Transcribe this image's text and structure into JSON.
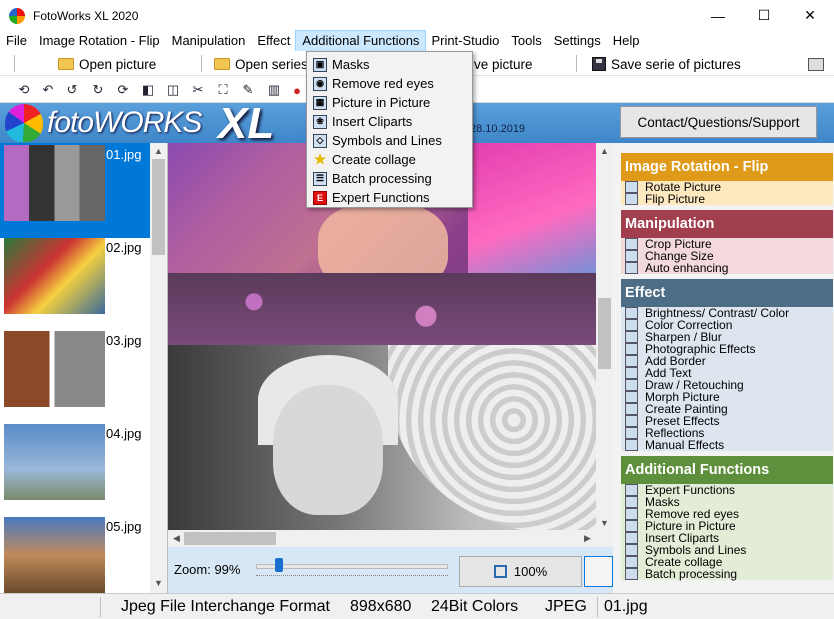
{
  "window": {
    "title": "FotoWorks XL 2020",
    "controls": {
      "minimize": "—",
      "maximize": "☐",
      "close": "✕"
    }
  },
  "menu": [
    "File",
    "Image Rotation - Flip",
    "Manipulation",
    "Effect",
    "Additional Functions",
    "Print-Studio",
    "Tools",
    "Settings",
    "Help"
  ],
  "toolbar": {
    "open_picture": "Open picture",
    "open_series": "Open series",
    "save_picture": "ve picture",
    "save_series": "Save serie of pictures"
  },
  "banner": {
    "logo_text": "fotoWORKS",
    "logo_xl": "XL",
    "date": "28.10.2019",
    "contact": "Contact/Questions/Support"
  },
  "dropdown": [
    {
      "label": "Masks",
      "icon": "masks-icon"
    },
    {
      "label": "Remove red eyes",
      "icon": "eye-icon"
    },
    {
      "label": "Picture in Picture",
      "icon": "picture-in-picture-icon"
    },
    {
      "label": "Insert Cliparts",
      "icon": "clipart-icon"
    },
    {
      "label": "Symbols and Lines",
      "icon": "symbols-icon"
    },
    {
      "label": "Create collage",
      "icon": "star-icon"
    },
    {
      "label": "Batch processing",
      "icon": "batch-icon"
    },
    {
      "label": "Expert Functions",
      "icon": "expert-icon"
    }
  ],
  "thumbnails": [
    {
      "label": "01.jpg",
      "selected": true
    },
    {
      "label": "02.jpg",
      "selected": false
    },
    {
      "label": "03.jpg",
      "selected": false
    },
    {
      "label": "04.jpg",
      "selected": false
    },
    {
      "label": "05.jpg",
      "selected": false
    }
  ],
  "zoom": {
    "label": "Zoom: 99%",
    "button": "100%",
    "slider_level": 0.1
  },
  "sections": [
    {
      "title": "Image Rotation - Flip",
      "color": "#e09a1a",
      "bg": "#fde8c0",
      "items": [
        "Rotate Picture",
        "Flip Picture"
      ]
    },
    {
      "title": "Manipulation",
      "color": "#a23f4e",
      "bg": "#f3d8dc",
      "items": [
        "Crop Picture",
        "Change Size",
        "Auto enhancing"
      ]
    },
    {
      "title": "Effect",
      "color": "#4d6d86",
      "bg": "#dde6ee",
      "items": [
        "Brightness/ Contrast/ Color",
        "Color Correction",
        "Sharpen / Blur",
        "Photographic Effects",
        "Add Border",
        "Add Text",
        "Draw / Retouching",
        "Morph Picture",
        "Create Painting",
        "Preset Effects",
        "Reflections",
        "Manual Effects"
      ]
    },
    {
      "title": "Additional Functions",
      "color": "#5e8f3c",
      "bg": "#e3ecd6",
      "items": [
        "Expert Functions",
        "Masks",
        "Remove red eyes",
        "Picture in Picture",
        "Insert Cliparts",
        "Symbols and Lines",
        "Create collage",
        "Batch processing"
      ]
    }
  ],
  "status": {
    "format": "Jpeg File Interchange Format",
    "size": "898x680",
    "colors": "24Bit Colors",
    "type": "JPEG",
    "file": "01.jpg"
  }
}
